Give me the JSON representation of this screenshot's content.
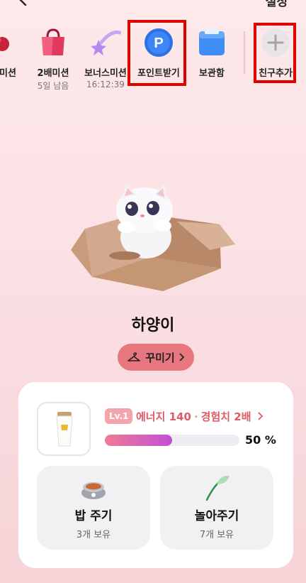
{
  "header": {
    "settings_label": "설정"
  },
  "missions": [
    {
      "label": "미션",
      "sub": "",
      "icon": "gift-ribbon-icon"
    },
    {
      "label": "2배미션",
      "sub": "5일 남음",
      "icon": "shopping-bag-icon"
    },
    {
      "label": "보너스미션",
      "sub": "16:12:39",
      "icon": "shooting-star-icon"
    },
    {
      "label": "포인트받기",
      "sub": "",
      "icon": "point-coin-icon"
    },
    {
      "label": "보관함",
      "sub": "",
      "icon": "storage-box-icon"
    },
    {
      "label": "친구추가",
      "sub": "",
      "icon": "plus-icon"
    }
  ],
  "character": {
    "name": "하양이",
    "decorate_label": "꾸미기"
  },
  "stats": {
    "level": "Lv.1",
    "energy": "에너지 140",
    "exp": "경험치 2배",
    "progress_percent": 50,
    "progress_label": "50 %"
  },
  "actions": [
    {
      "label": "밥 주기",
      "sub": "3개 보유",
      "icon": "food-bowl-icon"
    },
    {
      "label": "놀아주기",
      "sub": "7개 보유",
      "icon": "feather-toy-icon"
    }
  ],
  "colors": {
    "accent": "#e8767f",
    "energy_text": "#e05a66",
    "highlight": "#e00000"
  }
}
